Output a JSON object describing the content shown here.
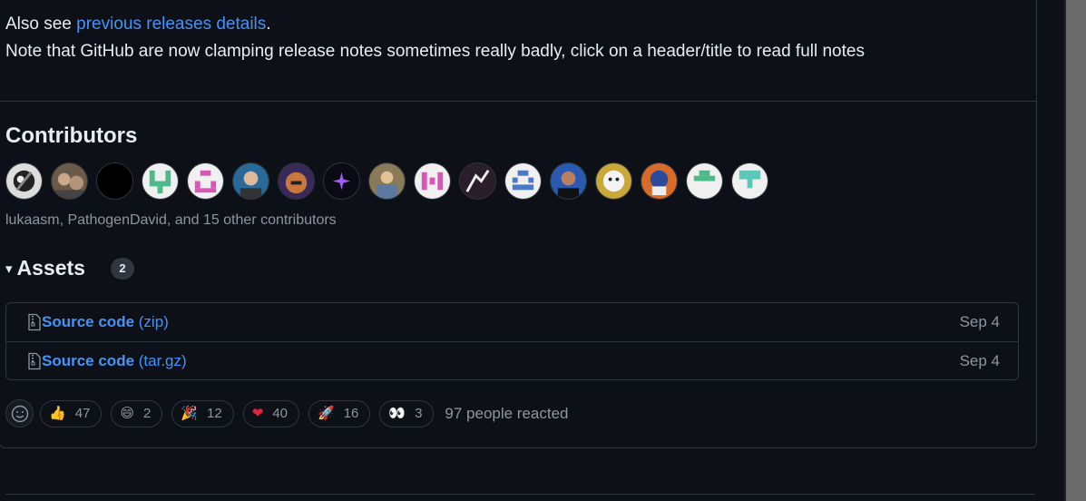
{
  "notes": {
    "line1_prefix": "Also see ",
    "line1_link": "previous releases details",
    "line1_suffix": ".",
    "line2": "Note that GitHub are now clamping release notes sometimes really badly, click on a header/title to read full notes"
  },
  "contributors": {
    "title": "Contributors",
    "summary": "lukaasm, PathogenDavid, and 15 other contributors"
  },
  "assets": {
    "title": "Assets",
    "count": "2",
    "items": [
      {
        "name": "Source code",
        "ext": " (zip)",
        "date": "Sep 4"
      },
      {
        "name": "Source code",
        "ext": " (tar.gz)",
        "date": "Sep 4"
      }
    ]
  },
  "reactions": {
    "items": [
      {
        "emoji": "👍",
        "count": "47"
      },
      {
        "emoji": "😄",
        "count": "2"
      },
      {
        "emoji": "🎉",
        "count": "12"
      },
      {
        "emoji": "❤",
        "count": "40"
      },
      {
        "emoji": "🚀",
        "count": "16"
      },
      {
        "emoji": "👀",
        "count": "3"
      }
    ],
    "summary": "97 people reacted"
  },
  "colors": {
    "background": "#0d1117",
    "link": "#4493f8",
    "muted": "#8d96a0",
    "border": "#30363d"
  }
}
